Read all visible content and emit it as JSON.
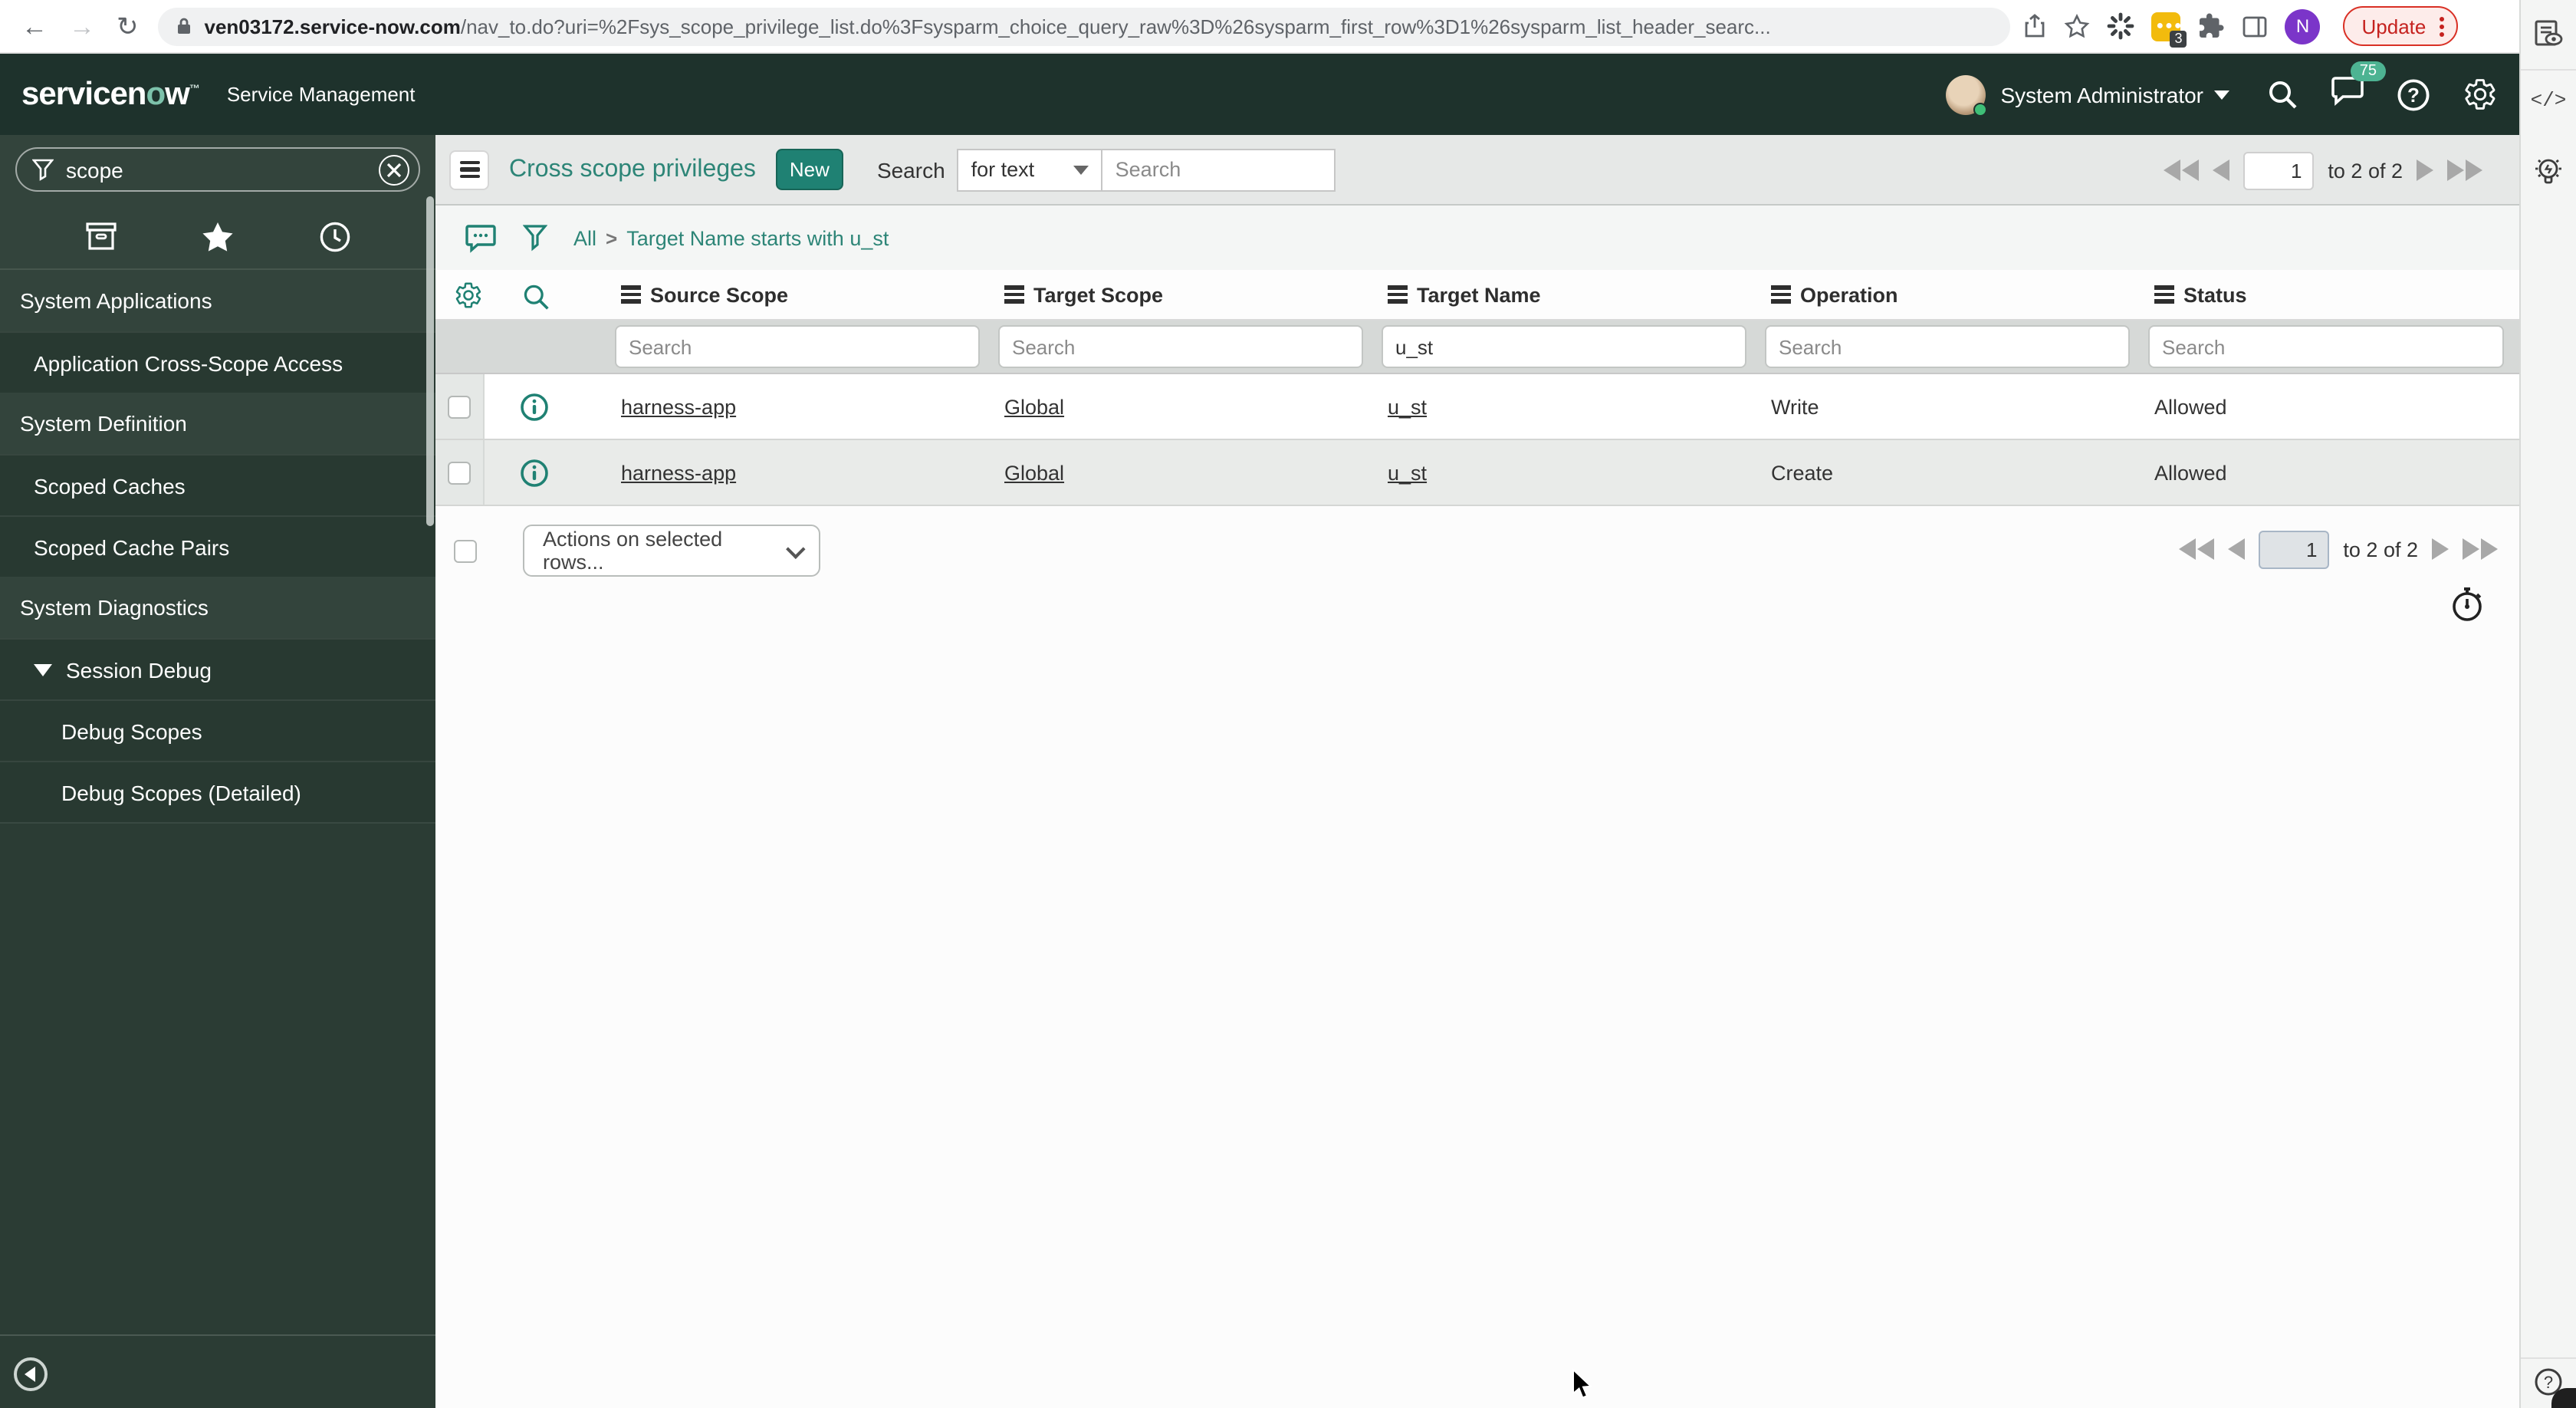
{
  "browser": {
    "url_domain": "ven03172.service-now.com",
    "url_path": "/nav_to.do?uri=%2Fsys_scope_privilege_list.do%3Fsysparm_choice_query_raw%3D%26sysparm_first_row%3D1%26sysparm_list_header_searc...",
    "update_label": "Update",
    "extension_badge": "3",
    "profile_initial": "N"
  },
  "nav": {
    "logo_pre": "servicen",
    "logo_o": "o",
    "logo_post": "w",
    "product": "Service Management",
    "user_name": "System Administrator",
    "notification_count": "75"
  },
  "glyphs": {
    "code": "</>",
    "question": "?"
  },
  "sidebar": {
    "filter_value": "scope",
    "items": [
      {
        "label": "System Applications",
        "type": "section"
      },
      {
        "label": "Application Cross-Scope Access",
        "type": "item"
      },
      {
        "label": "System Definition",
        "type": "section"
      },
      {
        "label": "Scoped Caches",
        "type": "item"
      },
      {
        "label": "Scoped Cache Pairs",
        "type": "item"
      },
      {
        "label": "System Diagnostics",
        "type": "section"
      },
      {
        "label": "Session Debug",
        "type": "item-expanded"
      },
      {
        "label": "Debug Scopes",
        "type": "subitem"
      },
      {
        "label": "Debug Scopes (Detailed)",
        "type": "subitem"
      }
    ]
  },
  "list": {
    "title": "Cross scope privileges",
    "new_button": "New",
    "search_label": "Search",
    "search_type": "for text",
    "search_placeholder": "Search",
    "breadcrumb": {
      "root": "All",
      "separator": ">",
      "filter": "Target Name starts with u_st"
    },
    "columns": [
      "Source Scope",
      "Target Scope",
      "Target Name",
      "Operation",
      "Status"
    ],
    "filters": {
      "placeholder": "Search",
      "target_name_value": "u_st"
    },
    "rows": [
      {
        "source_scope": "harness-app",
        "target_scope": "Global",
        "target_name": "u_st",
        "operation": "Write",
        "status": "Allowed"
      },
      {
        "source_scope": "harness-app",
        "target_scope": "Global",
        "target_name": "u_st",
        "operation": "Create",
        "status": "Allowed"
      }
    ],
    "actions_dropdown": "Actions on selected rows...",
    "pagination": {
      "page": "1",
      "range": "to 2 of 2"
    }
  }
}
